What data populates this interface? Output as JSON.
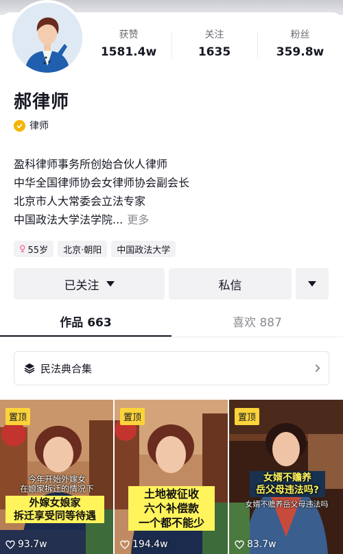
{
  "profile": {
    "name": "郝律师",
    "verify_label": "律师",
    "bio_lines": [
      "盈科律师事务所创始合伙人律师",
      "中华全国律师协会女律师协会副会长",
      "北京市人大常委会立法专家",
      "中国政法大学法学院..."
    ],
    "bio_more": "更多",
    "tags": [
      "55岁",
      "北京·朝阳",
      "中国政法大学"
    ]
  },
  "stats": [
    {
      "label": "获赞",
      "value": "1581.4w"
    },
    {
      "label": "关注",
      "value": "1635"
    },
    {
      "label": "粉丝",
      "value": "359.8w"
    }
  ],
  "actions": {
    "follow_label": "已关注",
    "message_label": "私信"
  },
  "tabs": [
    {
      "label": "作品 663"
    },
    {
      "label": "喜欢 887"
    }
  ],
  "collection": {
    "label": "民法典合集"
  },
  "videos": [
    {
      "pinned": "置顶",
      "caption_top": [
        "今年开始外嫁女",
        "在娘家拆迁的情况下"
      ],
      "caption_yellow": [
        "外嫁女娘家",
        "拆迁享受同等待遇"
      ],
      "likes": "93.7w"
    },
    {
      "pinned": "置顶",
      "caption_yellow": [
        "土地被征收",
        "六个补偿款",
        "一个都不能少"
      ],
      "likes": "194.4w"
    },
    {
      "pinned": "置顶",
      "caption_yellow": [
        "女婿不赡养",
        "岳父母违法吗?"
      ],
      "caption_bottom": "女婿不赡养岳父母违法吗",
      "likes": "83.7w"
    }
  ],
  "colors": {
    "pinned_bg": "#fcd43a",
    "verify_badge": "#f5b400",
    "female_icon": "#f35a85"
  }
}
